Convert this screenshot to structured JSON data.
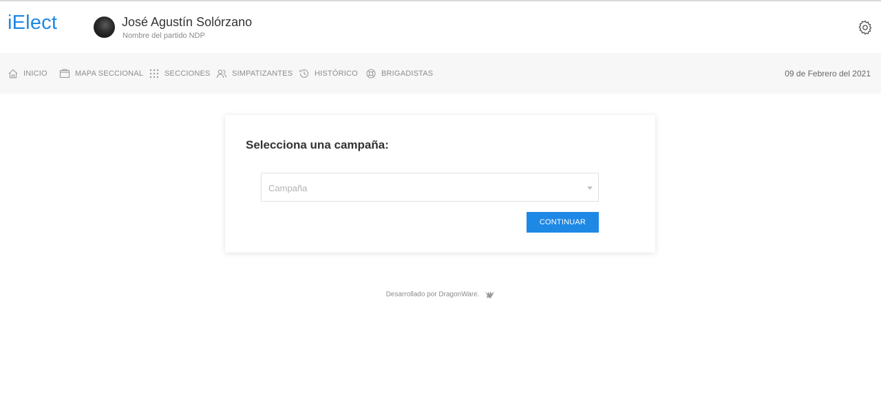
{
  "app": {
    "logo": "iElect"
  },
  "user": {
    "name": "José Agustín Solórzano",
    "party": "Nombre del partido NDP"
  },
  "nav": {
    "items": [
      {
        "label": "INICIO",
        "icon": "home-icon"
      },
      {
        "label": "MAPA SECCIONAL",
        "icon": "map-icon"
      },
      {
        "label": "SECCIONES",
        "icon": "grid-icon"
      },
      {
        "label": "SIMPATIZANTES",
        "icon": "users-icon"
      },
      {
        "label": "HISTÓRICO",
        "icon": "history-icon"
      },
      {
        "label": "BRIGADISTAS",
        "icon": "lifebuoy-icon"
      }
    ],
    "date": "09 de Febrero del 2021"
  },
  "card": {
    "title": "Selecciona una campaña:",
    "select_placeholder": "Campaña",
    "continue_label": "CONTINUAR"
  },
  "footer": {
    "text": "Desarrollado por DragonWare."
  },
  "colors": {
    "accent": "#1e88e5",
    "nav_bg": "#f7f7f7",
    "muted_text": "#8c8c8c"
  }
}
